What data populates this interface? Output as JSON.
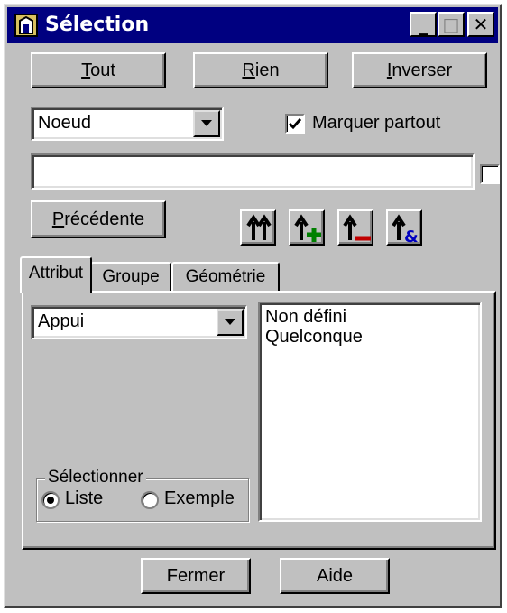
{
  "window": {
    "title": "Sélection",
    "minimize_glyph": "_",
    "maximize_glyph": "□",
    "close_glyph": "✕"
  },
  "buttons": {
    "tout": {
      "accel": "T",
      "rest": "out"
    },
    "rien": {
      "accel": "R",
      "rest": "ien"
    },
    "inverser": {
      "accel": "I",
      "rest": "nverser"
    },
    "precedente": {
      "accel": "P",
      "rest": "récédente"
    },
    "fermer": "Fermer",
    "aide": "Aide"
  },
  "type_combo": {
    "selected": "Noeud"
  },
  "marquer_partout": {
    "label": "Marquer partout",
    "checked": true
  },
  "filter_input": {
    "value": ""
  },
  "filter_checkbox": {
    "checked": false
  },
  "tools": [
    {
      "name": "all-up",
      "color": "#000000"
    },
    {
      "name": "add-up",
      "color": "#008000"
    },
    {
      "name": "remove-up",
      "color": "#c00000"
    },
    {
      "name": "and-up",
      "color": "#0000c0"
    }
  ],
  "tabs": [
    {
      "label": "Attribut",
      "active": true
    },
    {
      "label": "Groupe",
      "active": false
    },
    {
      "label": "Géométrie",
      "active": false
    }
  ],
  "attribute_combo": {
    "selected": "Appui"
  },
  "value_list": {
    "items": [
      "Non défini",
      "Quelconque"
    ]
  },
  "select_group": {
    "legend": "Sélectionner",
    "options": [
      {
        "label": "Liste",
        "selected": true
      },
      {
        "label": "Exemple",
        "selected": false
      }
    ]
  }
}
